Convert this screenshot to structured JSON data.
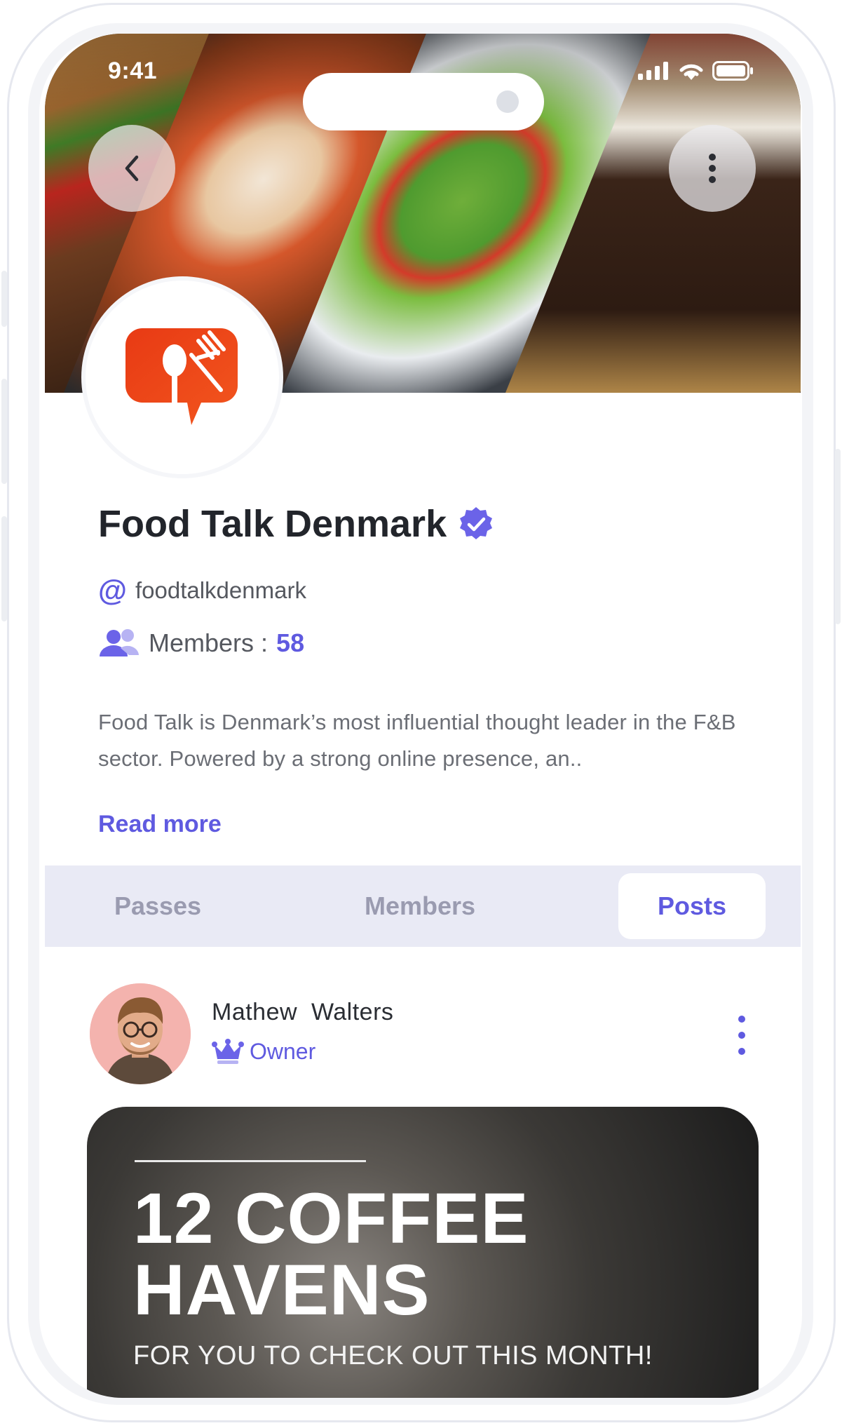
{
  "status_bar": {
    "time": "9:41"
  },
  "group": {
    "name": "Food Talk Denmark",
    "handle": "foodtalkdenmark",
    "members_label": "Members :",
    "members_count": "58",
    "description": "Food Talk is Denmark’s most influential thought leader in the F&B sector. Powered by a strong online presence, an..",
    "read_more": "Read more"
  },
  "tabs": [
    {
      "label": "Passes",
      "active": false
    },
    {
      "label": "Members",
      "active": false
    },
    {
      "label": "Posts",
      "active": true
    }
  ],
  "post": {
    "author": "Mathew  Walters",
    "role": "Owner",
    "headline_line1": "12 COFFEE",
    "headline_line2": "HAVENS",
    "subtitle": "FOR YOU TO CHECK OUT THIS MONTH!"
  },
  "colors": {
    "accent": "#5f5ae0",
    "logo": "#e8401a",
    "tab_bar": "#e9eaf5",
    "verified": "#6b63e8"
  }
}
